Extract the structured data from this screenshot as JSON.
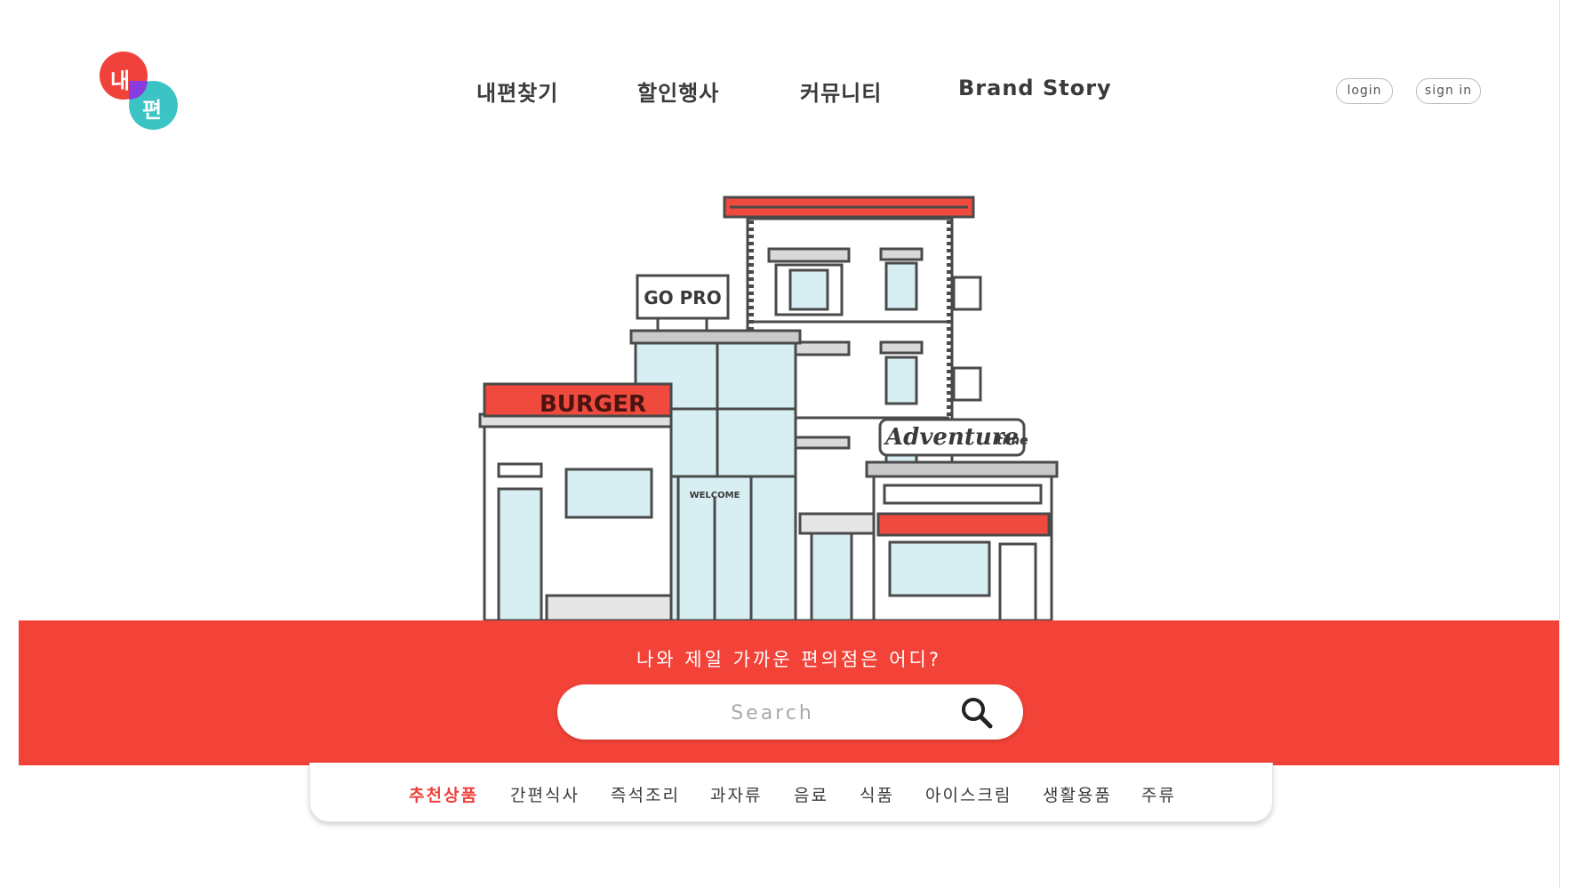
{
  "brand": {
    "logo_top": "내",
    "logo_bottom": "편",
    "red": "#f0413a",
    "teal": "#3cc3c3"
  },
  "nav": {
    "items": [
      "내편찾기",
      "할인행사",
      "커뮤니티",
      "Brand Story"
    ]
  },
  "auth": {
    "login": "login",
    "signin": "sign in"
  },
  "illustration": {
    "burger_sign": "BURGER",
    "gopro_sign": "GO PRO",
    "adventure_sign": "Adventure",
    "adventure_small": "time",
    "welcome_sign": "WELCOME"
  },
  "hero": {
    "title": "나와 제일 가까운 편의점은 어디?",
    "accent": "#f34237"
  },
  "search": {
    "placeholder": "Search"
  },
  "categories": {
    "items": [
      "추천상품",
      "간편식사",
      "즉석조리",
      "과자류",
      "음료",
      "식품",
      "아이스크림",
      "생활용품",
      "주류"
    ],
    "active": "추천상품"
  }
}
